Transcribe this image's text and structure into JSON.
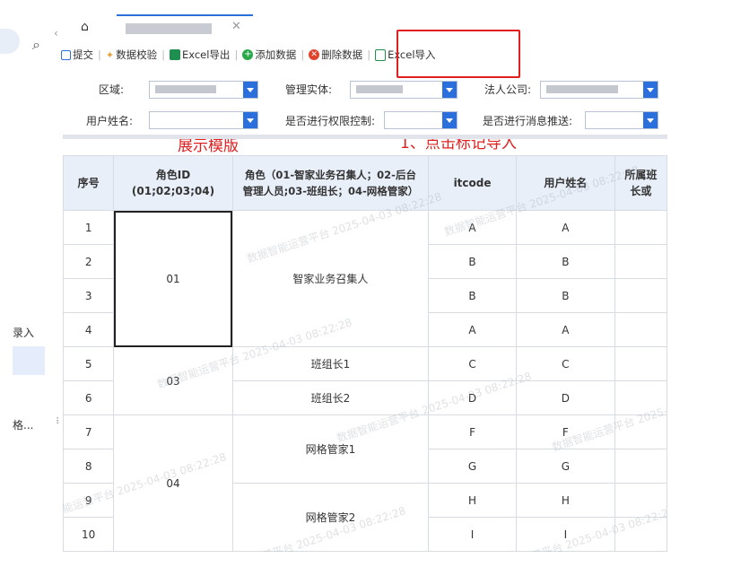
{
  "sidebar": {
    "luru_label": "录入",
    "gege_label": "格...",
    "search_icon": "search-icon"
  },
  "tabs": {
    "home_icon": "home-icon",
    "active_tab_label": ""
  },
  "toolbar": {
    "submit_label": "提交",
    "validate_label": "数据校验",
    "excel_export_label": "Excel导出",
    "add_data_label": "添加数据",
    "delete_data_label": "删除数据",
    "excel_import_label": "Excel导入"
  },
  "filters": {
    "region_label": "区域:",
    "management_entity_label": "管理实体:",
    "legal_company_label": "法人公司:",
    "user_name_label": "用户姓名:",
    "permission_control_label": "是否进行权限控制:",
    "message_push_label": "是否进行消息推送:"
  },
  "annotations": {
    "template_note": "展示模版",
    "step_note": "1、点击标记导入"
  },
  "table": {
    "headers": [
      "序号",
      "角色ID (01;02;03;04)",
      "角色（01-智家业务召集人；02-后台管理人员;03-班组长；04-网格管家）",
      "itcode",
      "用户姓名",
      "所属班组长或"
    ],
    "header_lines": {
      "h1": "序号",
      "h2a": "角色ID",
      "h2b": "(01;02;03;04)",
      "h3a": "角色（01-智家业务召集人；02-后台",
      "h3b": "管理人员;03-班组长；04-网格管家）",
      "h4": "itcode",
      "h5": "用户姓名",
      "h6a": "所属班",
      "h6b": "长或"
    },
    "seq": [
      "1",
      "2",
      "3",
      "4",
      "5",
      "6",
      "7",
      "8",
      "9",
      "10"
    ],
    "role_ids": [
      "01",
      "03",
      "04"
    ],
    "roles": [
      "智家业务召集人",
      "班组长1",
      "班组长2",
      "网格管家1",
      "网格管家2"
    ],
    "itcodes": [
      "A",
      "B",
      "B",
      "A",
      "C",
      "D",
      "F",
      "G",
      "H",
      "I"
    ],
    "user_names": [
      "A",
      "B",
      "B",
      "A",
      "C",
      "D",
      "F",
      "G",
      "H",
      "I"
    ]
  },
  "watermark": {
    "text": "数据智能运营平台 2025-04-03 08:22:28"
  },
  "colors": {
    "accent": "#2a6fdb",
    "annotation_red": "#e02020",
    "header_bg": "#e9eff8"
  }
}
